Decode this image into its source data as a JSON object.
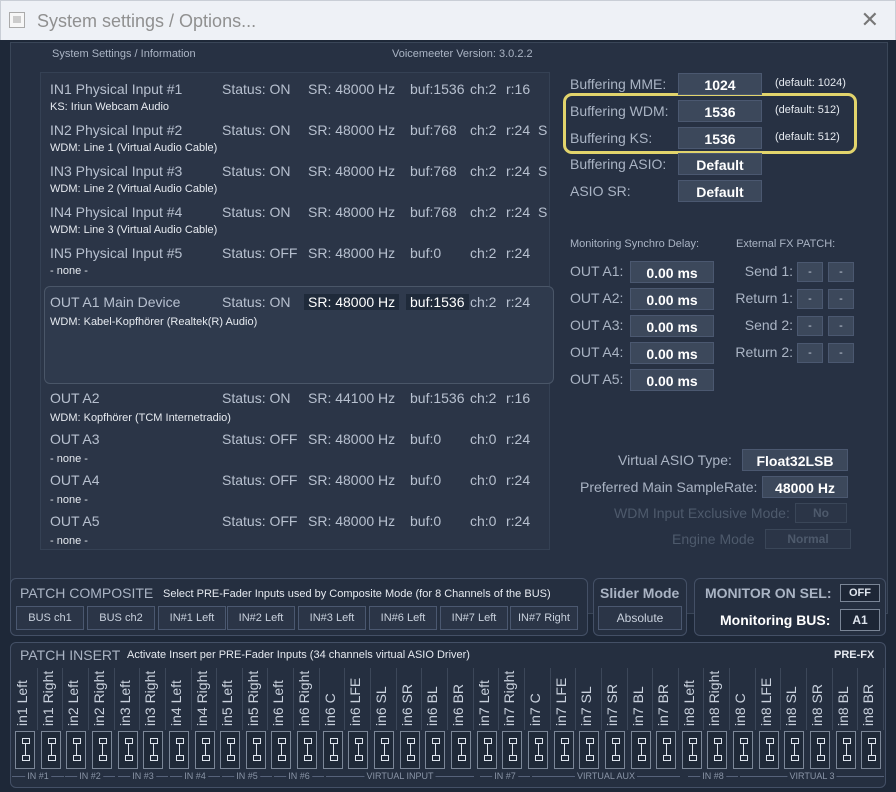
{
  "window": {
    "title": "System settings / Options...",
    "close": "✕"
  },
  "header": {
    "left": "System Settings / Information",
    "right": "Voicemeeter Version: 3.0.2.2"
  },
  "inputs": [
    {
      "name": "IN1 Physical Input #1",
      "status": "Status: ON",
      "sr": "SR: 48000 Hz",
      "buf": "buf:1536",
      "ch": "ch:2",
      "r": "r:16",
      "extra": "",
      "device": "KS: Iriun Webcam Audio"
    },
    {
      "name": "IN2 Physical Input #2",
      "status": "Status: ON",
      "sr": "SR: 48000 Hz",
      "buf": "buf:768",
      "ch": "ch:2",
      "r": "r:24",
      "extra": "S",
      "device": "WDM: Line 1 (Virtual Audio Cable)"
    },
    {
      "name": "IN3 Physical Input #3",
      "status": "Status: ON",
      "sr": "SR: 48000 Hz",
      "buf": "buf:768",
      "ch": "ch:2",
      "r": "r:24",
      "extra": "S",
      "device": "WDM: Line 2 (Virtual Audio Cable)"
    },
    {
      "name": "IN4 Physical Input #4",
      "status": "Status: ON",
      "sr": "SR: 48000 Hz",
      "buf": "buf:768",
      "ch": "ch:2",
      "r": "r:24",
      "extra": "S",
      "device": "WDM: Line 3 (Virtual Audio Cable)"
    },
    {
      "name": "IN5 Physical Input #5",
      "status": "Status: OFF",
      "sr": "SR: 48000 Hz",
      "buf": "buf:0",
      "ch": "ch:2",
      "r": "r:24",
      "extra": "",
      "device": "- none -"
    }
  ],
  "outputs": [
    {
      "name": "OUT A1 Main Device",
      "status": "Status: ON",
      "sr": "SR: 48000 Hz",
      "buf": "buf:1536",
      "ch": "ch:2",
      "r": "r:24",
      "device": "WDM: Kabel-Kopfhörer (Realtek(R) Audio)"
    },
    {
      "name": "OUT A2",
      "status": "Status: ON",
      "sr": "SR: 44100 Hz",
      "buf": "buf:1536",
      "ch": "ch:2",
      "r": "r:16",
      "device": "WDM: Kopfhörer (TCM Internetradio)"
    },
    {
      "name": "OUT A3",
      "status": "Status: OFF",
      "sr": "SR: 48000 Hz",
      "buf": "buf:0",
      "ch": "ch:0",
      "r": "r:24",
      "device": "- none -"
    },
    {
      "name": "OUT A4",
      "status": "Status: OFF",
      "sr": "SR: 48000 Hz",
      "buf": "buf:0",
      "ch": "ch:0",
      "r": "r:24",
      "device": "- none -"
    },
    {
      "name": "OUT A5",
      "status": "Status: OFF",
      "sr": "SR: 48000 Hz",
      "buf": "buf:0",
      "ch": "ch:0",
      "r": "r:24",
      "device": "- none -"
    }
  ],
  "buffering": [
    {
      "label": "Buffering MME:",
      "value": "1024",
      "default": "(default: 1024)"
    },
    {
      "label": "Buffering WDM:",
      "value": "1536",
      "default": "(default: 512)"
    },
    {
      "label": "Buffering KS:",
      "value": "1536",
      "default": "(default: 512)"
    },
    {
      "label": "Buffering ASIO:",
      "value": "Default",
      "default": ""
    },
    {
      "label": "ASIO SR:",
      "value": "Default",
      "default": ""
    }
  ],
  "monitoring": {
    "title": "Monitoring Synchro Delay:",
    "rows": [
      {
        "label": "OUT A1:",
        "value": "0.00 ms"
      },
      {
        "label": "OUT A2:",
        "value": "0.00 ms"
      },
      {
        "label": "OUT A3:",
        "value": "0.00 ms"
      },
      {
        "label": "OUT A4:",
        "value": "0.00 ms"
      },
      {
        "label": "OUT A5:",
        "value": "0.00 ms"
      }
    ]
  },
  "fxpatch": {
    "title": "External FX PATCH:",
    "rows": [
      {
        "label": "Send 1:",
        "a": "-",
        "b": "-"
      },
      {
        "label": "Return 1:",
        "a": "-",
        "b": "-"
      },
      {
        "label": "Send 2:",
        "a": "-",
        "b": "-"
      },
      {
        "label": "Return 2:",
        "a": "-",
        "b": "-"
      }
    ]
  },
  "asio": {
    "type_label": "Virtual ASIO Type:",
    "type_value": "Float32LSB",
    "sr_label": "Preferred Main SampleRate:",
    "sr_value": "48000 Hz",
    "wdm_label": "WDM Input Exclusive Mode:",
    "wdm_value": "No",
    "engine_label": "Engine Mode",
    "engine_value": "Normal"
  },
  "patch_composite": {
    "title": "PATCH COMPOSITE",
    "desc": "Select PRE-Fader Inputs used by Composite Mode (for 8 Channels of the BUS)",
    "buttons": [
      "BUS ch1",
      "BUS ch2",
      "IN#1 Left",
      "IN#2 Left",
      "IN#3 Left",
      "IN#6 Left",
      "IN#7 Left",
      "IN#7 Right"
    ]
  },
  "slider_mode": {
    "title": "Slider Mode",
    "value": "Absolute"
  },
  "monitor_on_sel": {
    "title": "MONITOR ON SEL:",
    "toggle": "OFF",
    "bus_label": "Monitoring BUS:",
    "bus_value": "A1"
  },
  "patch_insert": {
    "title": "PATCH INSERT",
    "desc": "Activate Insert per PRE-Fader Inputs (34 channels virtual ASIO Driver)",
    "mode": "PRE-FX",
    "channels": [
      "in1 Left",
      "in1 Right",
      "in2 Left",
      "in2 Right",
      "in3 Left",
      "in3 Right",
      "in4 Left",
      "in4 Right",
      "in5 Left",
      "in5 Right",
      "in6 Left",
      "in6 Right",
      "in6 C",
      "in6 LFE",
      "in6 SL",
      "in6 SR",
      "in6 BL",
      "in6 BR",
      "in7 Left",
      "in7 Right",
      "in7 C",
      "in7 LFE",
      "in7 SL",
      "in7 SR",
      "in7 BL",
      "in7 BR",
      "in8 Left",
      "in8 Right",
      "in8 C",
      "in8 LFE",
      "in8 SL",
      "in8 SR",
      "in8 BL",
      "in8 BR"
    ],
    "groups": [
      "IN #1",
      "IN #2",
      "IN #3",
      "IN #4",
      "IN #5",
      "IN #6",
      "VIRTUAL INPUT",
      "IN #7",
      "VIRTUAL AUX",
      "IN #8",
      "VIRTUAL 3"
    ]
  }
}
